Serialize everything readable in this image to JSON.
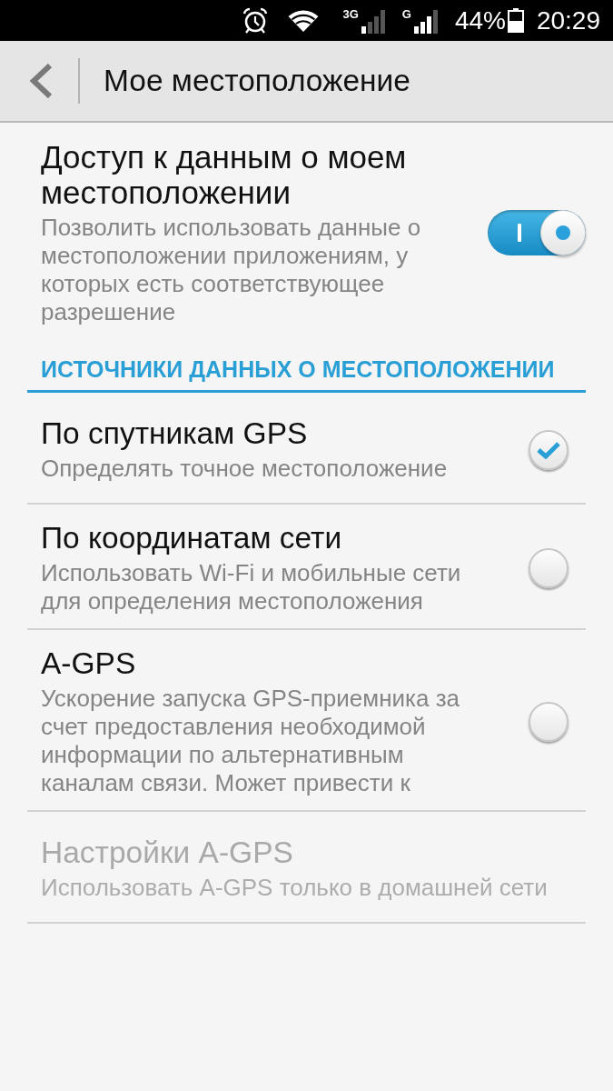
{
  "status_bar": {
    "networks": [
      {
        "label": "3G",
        "kind": "weak"
      },
      {
        "label": "G",
        "kind": "fair"
      }
    ],
    "battery": "44%",
    "time": "20:29"
  },
  "action_bar": {
    "title": "Мое местоположение"
  },
  "master": {
    "title": "Доступ к данным о моем местоположении",
    "summary": "Позволить использовать данные о местоположении приложениям, у которых есть соответствующее разрешение",
    "on": true
  },
  "section": {
    "title": "ИСТОЧНИКИ ДАННЫХ О МЕСТОПОЛОЖЕНИИ"
  },
  "items": [
    {
      "kind": "checkbox",
      "title": "По спутникам GPS",
      "summary": "Определять точное местоположение",
      "checked": true,
      "disabled": false
    },
    {
      "kind": "checkbox",
      "title": "По координатам сети",
      "summary": "Использовать Wi-Fi и мобильные сети для определения местоположения",
      "checked": false,
      "disabled": false
    },
    {
      "kind": "checkbox",
      "title": "A-GPS",
      "summary": "Ускорение запуска GPS-приемника за счет предоставления необходимой информации по альтернативным каналам связи. Может привести к",
      "checked": false,
      "disabled": false
    },
    {
      "kind": "plain",
      "title": "Настройки A-GPS",
      "summary": "Использовать A-GPS только в домашней сети",
      "disabled": true
    }
  ]
}
